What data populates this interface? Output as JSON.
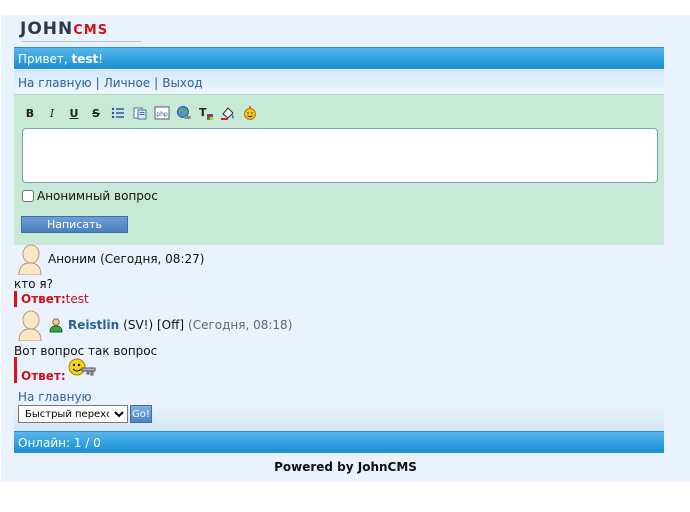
{
  "logo": {
    "part1": "JOHN",
    "part2": "CMS"
  },
  "header": {
    "greeting_prefix": "Привет, ",
    "username": "test",
    "greeting_suffix": "!"
  },
  "nav": {
    "home": "На главную",
    "sep": "|",
    "personal": "Личное",
    "logout": "Выход"
  },
  "toolbar": {
    "bold": "B",
    "italic": "I",
    "underline": "U",
    "strike": "S"
  },
  "form": {
    "message_value": "",
    "anon_label": "Анонимный вопрос",
    "anon_checked": false,
    "submit_label": "Написать"
  },
  "posts": [
    {
      "author": "Аноним",
      "meta": "(Сегодня, 08:27)",
      "text": "кто я?",
      "answer_label": "Ответ:",
      "answer_text": "test"
    },
    {
      "author": "Reistlin",
      "status": "(SV!) [Off]",
      "meta": "(Сегодня, 08:18)",
      "text": "Вот вопрос так вопрос",
      "answer_label": "Ответ:"
    }
  ],
  "footer_nav": {
    "home": "На главную",
    "jump_selected": "Быстрый переход",
    "go_label": "Go!"
  },
  "online": "Онлайн: 1 / 0",
  "powered": "Powered by JohnCMS",
  "colors": {
    "bar": "#1a8fd4",
    "editor_bg": "#c8e9d6",
    "accent_red": "#d0101a",
    "link": "#2e5f9a"
  }
}
